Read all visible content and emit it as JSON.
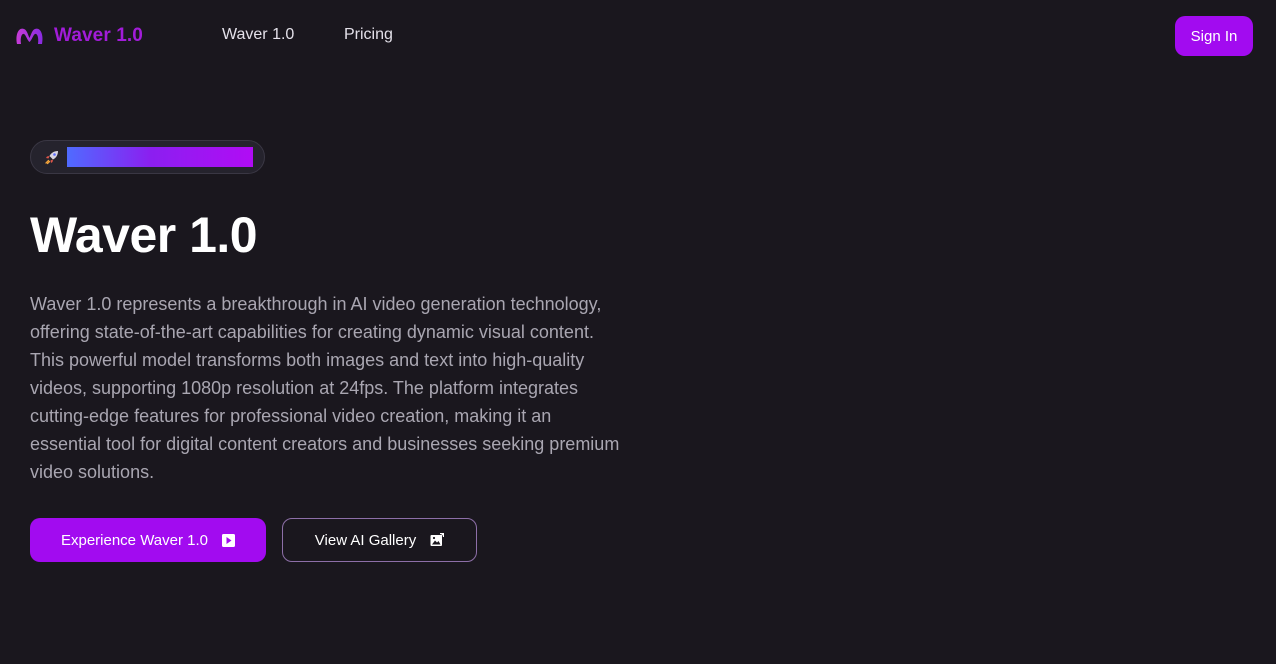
{
  "header": {
    "brand": "Waver 1.0",
    "nav": [
      {
        "label": "Waver 1.0"
      },
      {
        "label": "Pricing"
      }
    ],
    "sign_in": "Sign In"
  },
  "hero": {
    "badge_icon": "rocket-icon",
    "title": "Waver 1.0",
    "description": "Waver 1.0 represents a breakthrough in AI video generation technology, offering state-of-the-art capabilities for creating dynamic visual content. This powerful model transforms both images and text into high-quality videos, supporting 1080p resolution at 24fps. The platform integrates cutting-edge features for professional video creation, making it an essential tool for digital content creators and businesses seeking premium video solutions.",
    "primary_button": {
      "label": "Experience Waver 1.0",
      "icon": "play-icon"
    },
    "secondary_button": {
      "label": "View AI Gallery",
      "icon": "gallery-icon"
    }
  },
  "colors": {
    "background": "#1a171e",
    "accent": "#a20bf0",
    "text_muted": "#a9a6b1"
  }
}
